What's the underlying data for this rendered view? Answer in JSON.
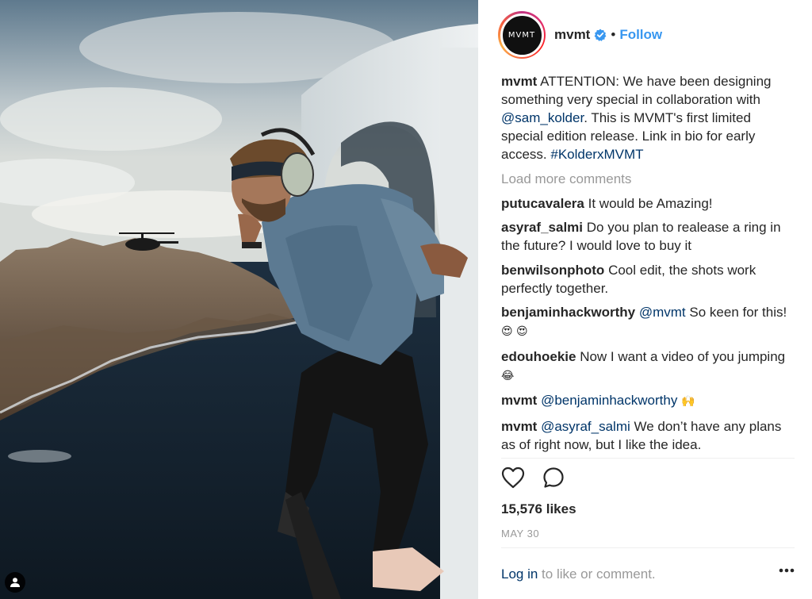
{
  "post": {
    "username": "mvmt",
    "avatar_text": "MVMT",
    "dot": "•",
    "follow_label": "Follow",
    "caption_user": "mvmt",
    "caption_parts": [
      "ATTENTION: We have been designing something very special in collaboration with ",
      "@sam_kolder",
      ". This is MVMT's first limited special edition release. Link in bio for early access. ",
      "#KolderxMVMT"
    ],
    "load_more": "Load more comments",
    "comments": [
      {
        "user": "putucavalera",
        "text": "It would be Amazing!"
      },
      {
        "user": "asyraf_salmi",
        "text": "Do you plan to realease a ring in the future? I would love to buy it"
      },
      {
        "user": "benwilsonphoto",
        "text": "Cool edit, the shots work perfectly together."
      },
      {
        "user": "benjaminhackworthy",
        "mention": "@mvmt",
        "text": "So keen for this!",
        "emoji": "😍 😍"
      },
      {
        "user": "edouhoekie",
        "text": "Now I want a video of you jumping",
        "emoji": "😂"
      },
      {
        "user": "mvmt",
        "mention": "@benjaminhackworthy",
        "text": "",
        "emoji": "🙌"
      },
      {
        "user": "mvmt",
        "mention": "@asyraf_salmi",
        "text": "We don’t have any plans as of right now, but I like the idea."
      }
    ],
    "likes": "15,576 likes",
    "date": "MAY 30",
    "login_link": "Log in",
    "login_rest": " to like or comment."
  },
  "icons": {
    "verified": "verified-badge-icon",
    "like": "heart-icon",
    "comment": "speech-bubble-icon",
    "more": "ellipsis-icon",
    "tag": "user-tag-icon"
  },
  "colors": {
    "link": "#003569",
    "follow": "#3897f0",
    "muted": "#999999",
    "text": "#262626"
  }
}
